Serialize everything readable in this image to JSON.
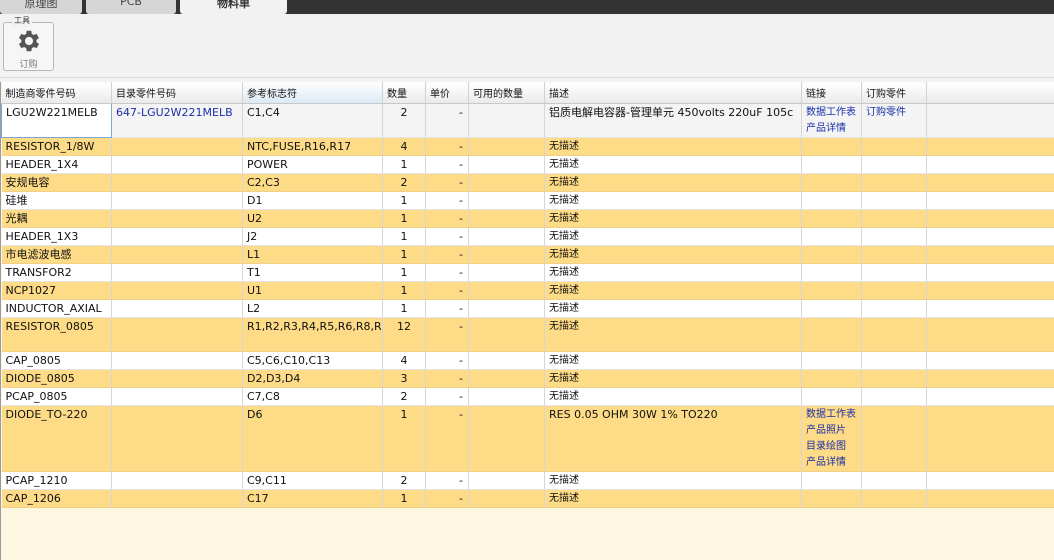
{
  "tabs": [
    "原理图",
    "PCB",
    "物料单"
  ],
  "toolbar": {
    "group_label": "工具",
    "order_button": "订购",
    "icon": "gear-icon"
  },
  "columns": [
    "制造商零件号码",
    "目录零件号码",
    "参考标志符",
    "数量",
    "单价",
    "可用的数量",
    "描述",
    "链接",
    "订购零件",
    ""
  ],
  "rows": [
    {
      "mfr": "LGU2W221MELB",
      "catalog": "647-LGU2W221MELB",
      "ref": "C1,C4",
      "qty": "2",
      "price": "-",
      "avail": "",
      "desc": "铝质电解电容器-管理单元  450volts 220uF 105c",
      "links": [
        "数据工作表",
        "产品详情"
      ],
      "order": "订购零件"
    },
    {
      "mfr": "RESISTOR_1/8W",
      "catalog": "",
      "ref": "NTC,FUSE,R16,R17",
      "qty": "4",
      "price": "-",
      "avail": "",
      "desc": "无描述",
      "links": [],
      "order": ""
    },
    {
      "mfr": "HEADER_1X4",
      "catalog": "",
      "ref": "POWER",
      "qty": "1",
      "price": "-",
      "avail": "",
      "desc": "无描述",
      "links": [],
      "order": ""
    },
    {
      "mfr": "安规电容",
      "catalog": "",
      "ref": "C2,C3",
      "qty": "2",
      "price": "-",
      "avail": "",
      "desc": "无描述",
      "links": [],
      "order": ""
    },
    {
      "mfr": "硅堆",
      "catalog": "",
      "ref": "D1",
      "qty": "1",
      "price": "-",
      "avail": "",
      "desc": "无描述",
      "links": [],
      "order": ""
    },
    {
      "mfr": "光耦",
      "catalog": "",
      "ref": "U2",
      "qty": "1",
      "price": "-",
      "avail": "",
      "desc": "无描述",
      "links": [],
      "order": ""
    },
    {
      "mfr": "HEADER_1X3",
      "catalog": "",
      "ref": "J2",
      "qty": "1",
      "price": "-",
      "avail": "",
      "desc": "无描述",
      "links": [],
      "order": ""
    },
    {
      "mfr": "市电滤波电感",
      "catalog": "",
      "ref": "L1",
      "qty": "1",
      "price": "-",
      "avail": "",
      "desc": "无描述",
      "links": [],
      "order": ""
    },
    {
      "mfr": "TRANSFOR2",
      "catalog": "",
      "ref": "T1",
      "qty": "1",
      "price": "-",
      "avail": "",
      "desc": "无描述",
      "links": [],
      "order": ""
    },
    {
      "mfr": "NCP1027",
      "catalog": "",
      "ref": "U1",
      "qty": "1",
      "price": "-",
      "avail": "",
      "desc": "无描述",
      "links": [],
      "order": ""
    },
    {
      "mfr": "INDUCTOR_AXIAL",
      "catalog": "",
      "ref": "L2",
      "qty": "1",
      "price": "-",
      "avail": "",
      "desc": "无描述",
      "links": [],
      "order": ""
    },
    {
      "mfr": "RESISTOR_0805",
      "catalog": "",
      "ref": "R1,R2,R3,R4,R5,R6,R8,R9,R11,R7,R10,R14",
      "qty": "12",
      "price": "-",
      "avail": "",
      "desc": "无描述",
      "links": [],
      "order": ""
    },
    {
      "mfr": "CAP_0805",
      "catalog": "",
      "ref": "C5,C6,C10,C13",
      "qty": "4",
      "price": "-",
      "avail": "",
      "desc": "无描述",
      "links": [],
      "order": ""
    },
    {
      "mfr": "DIODE_0805",
      "catalog": "",
      "ref": "D2,D3,D4",
      "qty": "3",
      "price": "-",
      "avail": "",
      "desc": "无描述",
      "links": [],
      "order": ""
    },
    {
      "mfr": "PCAP_0805",
      "catalog": "",
      "ref": "C7,C8",
      "qty": "2",
      "price": "-",
      "avail": "",
      "desc": "无描述",
      "links": [],
      "order": ""
    },
    {
      "mfr": "DIODE_TO-220",
      "catalog": "",
      "ref": "D6",
      "qty": "1",
      "price": "-",
      "avail": "",
      "desc": "RES 0.05 OHM 30W 1% TO220",
      "links": [
        "数据工作表",
        "产品照片",
        "目录绘图",
        "产品详情"
      ],
      "order": ""
    },
    {
      "mfr": "PCAP_1210",
      "catalog": "",
      "ref": "C9,C11",
      "qty": "2",
      "price": "-",
      "avail": "",
      "desc": "无描述",
      "links": [],
      "order": ""
    },
    {
      "mfr": "CAP_1206",
      "catalog": "",
      "ref": "C17",
      "qty": "1",
      "price": "-",
      "avail": "",
      "desc": "无描述",
      "links": [],
      "order": ""
    }
  ],
  "colors": {
    "row_alt": "#fedb86",
    "link": "#1a2fa8",
    "tabbar": "#333333"
  }
}
